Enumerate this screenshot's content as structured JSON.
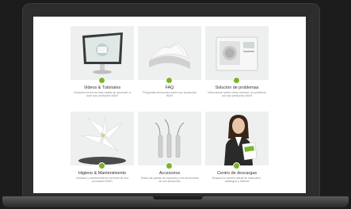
{
  "colors": {
    "accent": "#79b52a",
    "page": "#ffffff",
    "thumb": "#e9eaea"
  },
  "tiles": [
    {
      "title": "Videos & Tutoriales",
      "icon": "monitor-icon",
      "desc": "Descubra la forma más rápida de aprender a usar sus productos W&H"
    },
    {
      "title": "FAQ",
      "icon": "book-icon",
      "desc": "Preguntas frecuentes sobre sus productos W&H"
    },
    {
      "title": "Solución de problemas",
      "icon": "sterilizer-icon",
      "desc": "Información sobre cómo resolver un problema con sus productos W&H"
    },
    {
      "title": "Higiene & Mantenimiento",
      "icon": "lily-icon",
      "desc": "Cuidado y mantenimiento correcto de sus productos W&H"
    },
    {
      "title": "Accesorios",
      "icon": "scaler-tips-icon",
      "desc": "Todas las piezas de repuesto y los accesorios de sus productos"
    },
    {
      "title": "Centro de descargas",
      "icon": "woman-with-brochure-icon",
      "desc": "Busque la versión actual de manuales, catálogos y folletos"
    }
  ]
}
